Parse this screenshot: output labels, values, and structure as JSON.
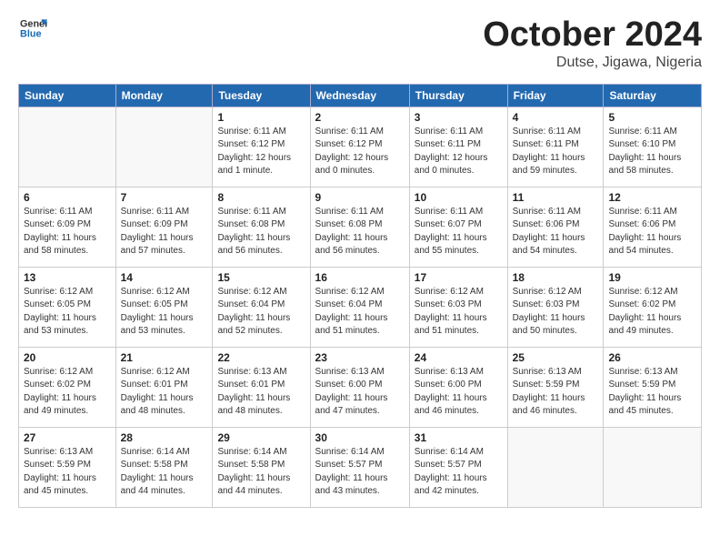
{
  "header": {
    "logo_general": "General",
    "logo_blue": "Blue",
    "title": "October 2024",
    "location": "Dutse, Jigawa, Nigeria"
  },
  "weekdays": [
    "Sunday",
    "Monday",
    "Tuesday",
    "Wednesday",
    "Thursday",
    "Friday",
    "Saturday"
  ],
  "weeks": [
    [
      {
        "day": "",
        "detail": ""
      },
      {
        "day": "",
        "detail": ""
      },
      {
        "day": "1",
        "detail": "Sunrise: 6:11 AM\nSunset: 6:12 PM\nDaylight: 12 hours\nand 1 minute."
      },
      {
        "day": "2",
        "detail": "Sunrise: 6:11 AM\nSunset: 6:12 PM\nDaylight: 12 hours\nand 0 minutes."
      },
      {
        "day": "3",
        "detail": "Sunrise: 6:11 AM\nSunset: 6:11 PM\nDaylight: 12 hours\nand 0 minutes."
      },
      {
        "day": "4",
        "detail": "Sunrise: 6:11 AM\nSunset: 6:11 PM\nDaylight: 11 hours\nand 59 minutes."
      },
      {
        "day": "5",
        "detail": "Sunrise: 6:11 AM\nSunset: 6:10 PM\nDaylight: 11 hours\nand 58 minutes."
      }
    ],
    [
      {
        "day": "6",
        "detail": "Sunrise: 6:11 AM\nSunset: 6:09 PM\nDaylight: 11 hours\nand 58 minutes."
      },
      {
        "day": "7",
        "detail": "Sunrise: 6:11 AM\nSunset: 6:09 PM\nDaylight: 11 hours\nand 57 minutes."
      },
      {
        "day": "8",
        "detail": "Sunrise: 6:11 AM\nSunset: 6:08 PM\nDaylight: 11 hours\nand 56 minutes."
      },
      {
        "day": "9",
        "detail": "Sunrise: 6:11 AM\nSunset: 6:08 PM\nDaylight: 11 hours\nand 56 minutes."
      },
      {
        "day": "10",
        "detail": "Sunrise: 6:11 AM\nSunset: 6:07 PM\nDaylight: 11 hours\nand 55 minutes."
      },
      {
        "day": "11",
        "detail": "Sunrise: 6:11 AM\nSunset: 6:06 PM\nDaylight: 11 hours\nand 54 minutes."
      },
      {
        "day": "12",
        "detail": "Sunrise: 6:11 AM\nSunset: 6:06 PM\nDaylight: 11 hours\nand 54 minutes."
      }
    ],
    [
      {
        "day": "13",
        "detail": "Sunrise: 6:12 AM\nSunset: 6:05 PM\nDaylight: 11 hours\nand 53 minutes."
      },
      {
        "day": "14",
        "detail": "Sunrise: 6:12 AM\nSunset: 6:05 PM\nDaylight: 11 hours\nand 53 minutes."
      },
      {
        "day": "15",
        "detail": "Sunrise: 6:12 AM\nSunset: 6:04 PM\nDaylight: 11 hours\nand 52 minutes."
      },
      {
        "day": "16",
        "detail": "Sunrise: 6:12 AM\nSunset: 6:04 PM\nDaylight: 11 hours\nand 51 minutes."
      },
      {
        "day": "17",
        "detail": "Sunrise: 6:12 AM\nSunset: 6:03 PM\nDaylight: 11 hours\nand 51 minutes."
      },
      {
        "day": "18",
        "detail": "Sunrise: 6:12 AM\nSunset: 6:03 PM\nDaylight: 11 hours\nand 50 minutes."
      },
      {
        "day": "19",
        "detail": "Sunrise: 6:12 AM\nSunset: 6:02 PM\nDaylight: 11 hours\nand 49 minutes."
      }
    ],
    [
      {
        "day": "20",
        "detail": "Sunrise: 6:12 AM\nSunset: 6:02 PM\nDaylight: 11 hours\nand 49 minutes."
      },
      {
        "day": "21",
        "detail": "Sunrise: 6:12 AM\nSunset: 6:01 PM\nDaylight: 11 hours\nand 48 minutes."
      },
      {
        "day": "22",
        "detail": "Sunrise: 6:13 AM\nSunset: 6:01 PM\nDaylight: 11 hours\nand 48 minutes."
      },
      {
        "day": "23",
        "detail": "Sunrise: 6:13 AM\nSunset: 6:00 PM\nDaylight: 11 hours\nand 47 minutes."
      },
      {
        "day": "24",
        "detail": "Sunrise: 6:13 AM\nSunset: 6:00 PM\nDaylight: 11 hours\nand 46 minutes."
      },
      {
        "day": "25",
        "detail": "Sunrise: 6:13 AM\nSunset: 5:59 PM\nDaylight: 11 hours\nand 46 minutes."
      },
      {
        "day": "26",
        "detail": "Sunrise: 6:13 AM\nSunset: 5:59 PM\nDaylight: 11 hours\nand 45 minutes."
      }
    ],
    [
      {
        "day": "27",
        "detail": "Sunrise: 6:13 AM\nSunset: 5:59 PM\nDaylight: 11 hours\nand 45 minutes."
      },
      {
        "day": "28",
        "detail": "Sunrise: 6:14 AM\nSunset: 5:58 PM\nDaylight: 11 hours\nand 44 minutes."
      },
      {
        "day": "29",
        "detail": "Sunrise: 6:14 AM\nSunset: 5:58 PM\nDaylight: 11 hours\nand 44 minutes."
      },
      {
        "day": "30",
        "detail": "Sunrise: 6:14 AM\nSunset: 5:57 PM\nDaylight: 11 hours\nand 43 minutes."
      },
      {
        "day": "31",
        "detail": "Sunrise: 6:14 AM\nSunset: 5:57 PM\nDaylight: 11 hours\nand 42 minutes."
      },
      {
        "day": "",
        "detail": ""
      },
      {
        "day": "",
        "detail": ""
      }
    ]
  ]
}
